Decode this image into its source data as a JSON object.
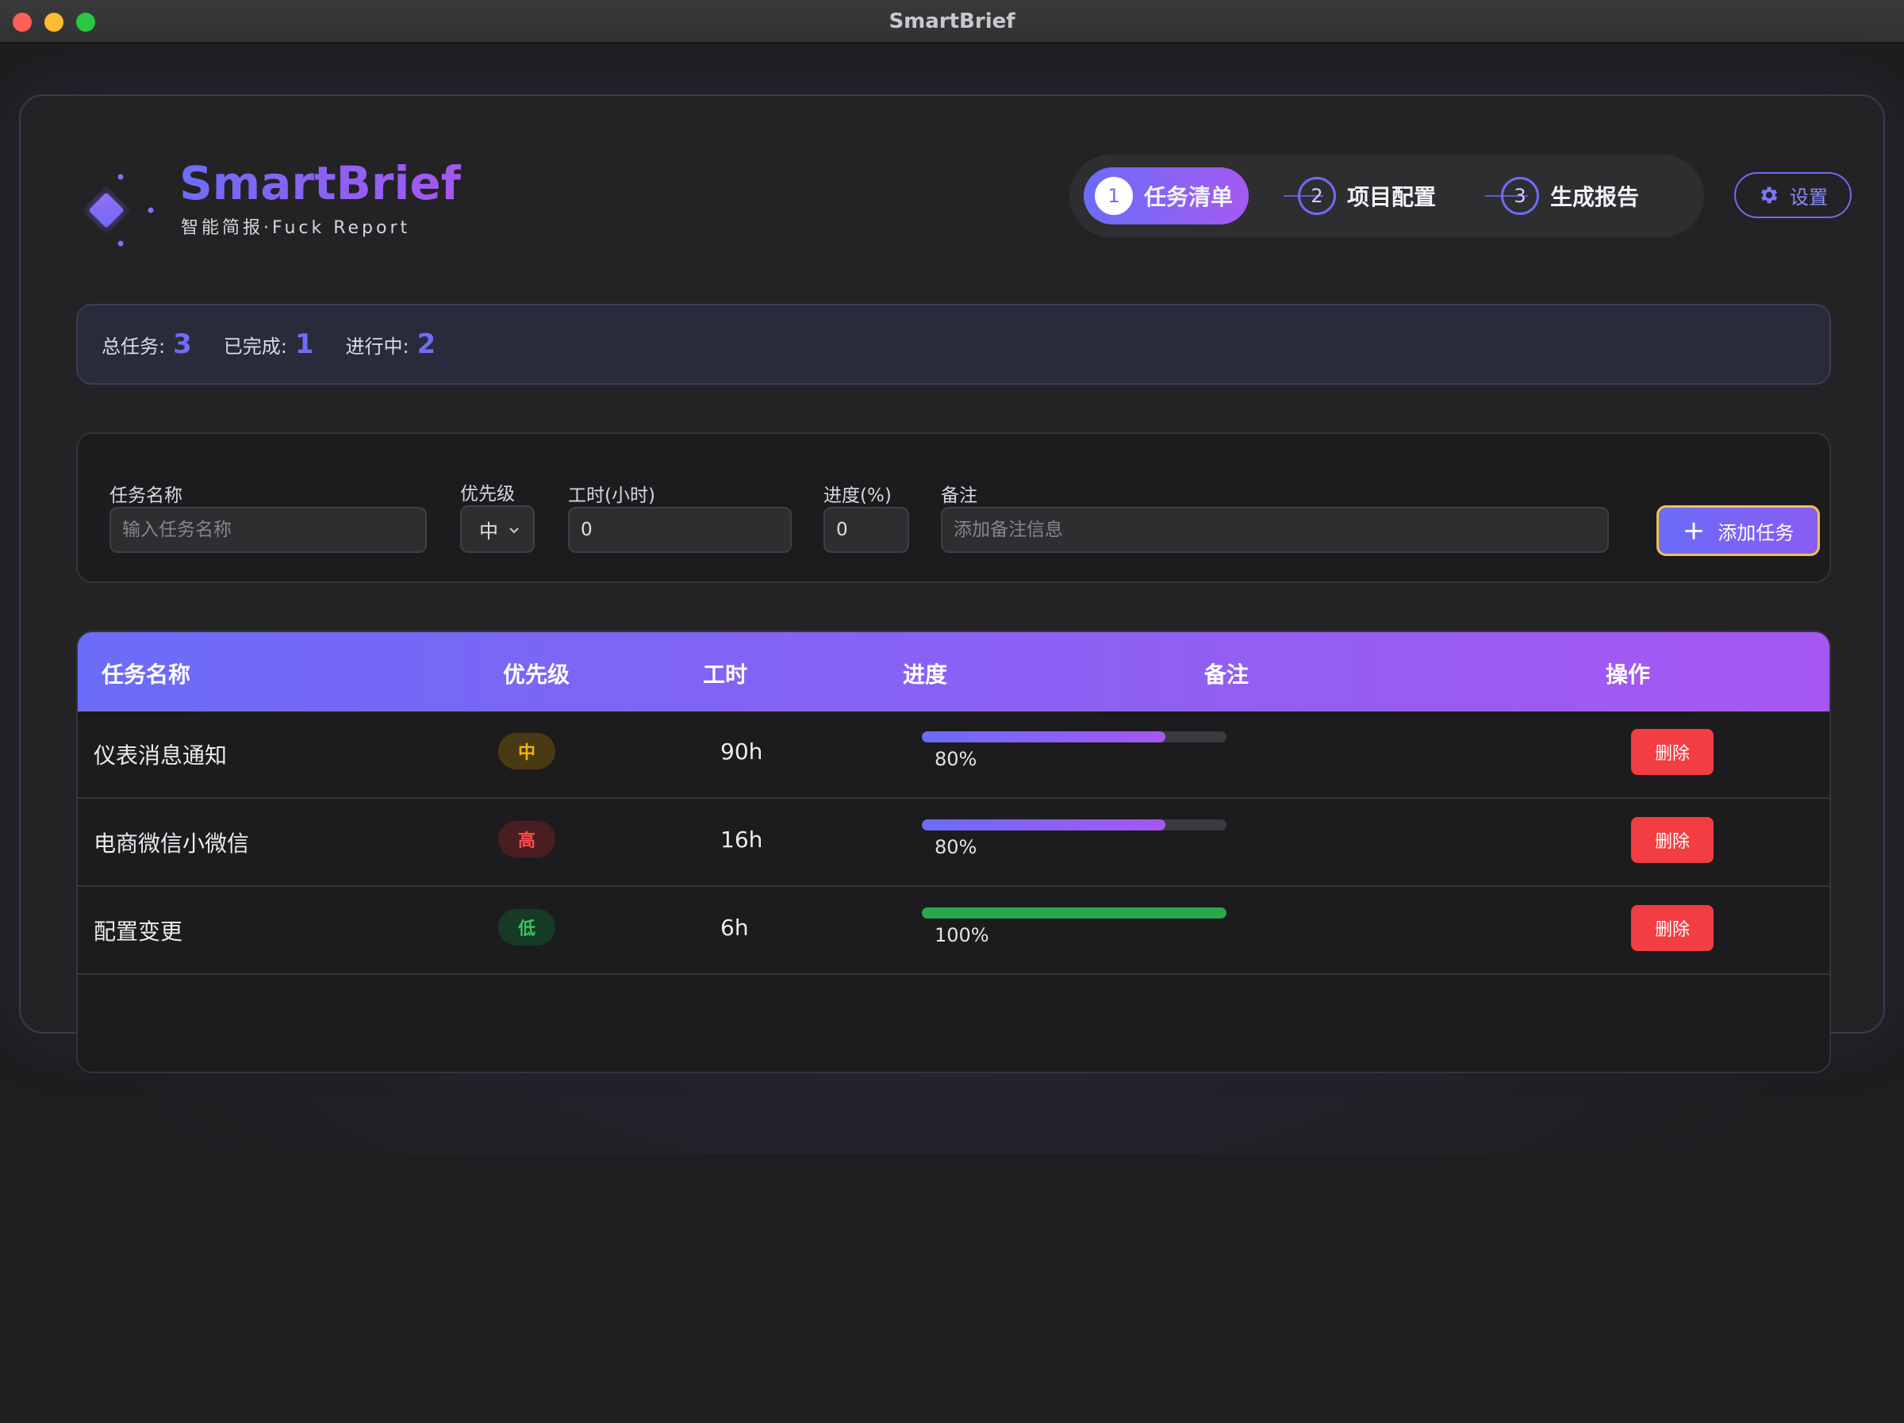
{
  "window": {
    "title": "SmartBrief"
  },
  "brand": {
    "name": "SmartBrief",
    "subtitle": "智能简报·Fuck Report"
  },
  "steps": [
    {
      "num": "1",
      "label": "任务清单",
      "active": true
    },
    {
      "num": "2",
      "label": "项目配置",
      "active": false
    },
    {
      "num": "3",
      "label": "生成报告",
      "active": false
    }
  ],
  "settings": {
    "label": "设置",
    "icon": "gear-icon"
  },
  "stats": {
    "total_label": "总任务:",
    "total_value": "3",
    "done_label": "已完成:",
    "done_value": "1",
    "progress_label": "进行中:",
    "progress_value": "2"
  },
  "form": {
    "name_label": "任务名称",
    "name_placeholder": "输入任务名称",
    "priority_label": "优先级",
    "priority_value": "中",
    "hours_label": "工时(小时)",
    "hours_value": "0",
    "progress_label": "进度(%)",
    "progress_value": "0",
    "note_label": "备注",
    "note_placeholder": "添加备注信息",
    "add_label": "添加任务"
  },
  "table": {
    "headers": [
      "任务名称",
      "优先级",
      "工时",
      "进度",
      "备注",
      "操作"
    ],
    "rows": [
      {
        "name": "仪表消息通知",
        "priority": "中",
        "priority_level": "medium",
        "hours": "90h",
        "progress": 80,
        "progress_label": "80%",
        "note": "",
        "action": "删除"
      },
      {
        "name": "电商微信小微信",
        "priority": "高",
        "priority_level": "high",
        "hours": "16h",
        "progress": 80,
        "progress_label": "80%",
        "note": "",
        "action": "删除"
      },
      {
        "name": "配置变更",
        "priority": "低",
        "priority_level": "low",
        "hours": "6h",
        "progress": 100,
        "progress_label": "100%",
        "note": "",
        "action": "删除"
      }
    ]
  },
  "colors": {
    "accent": "#6b6cf7",
    "accent_end": "#a657f1",
    "danger": "#f23d42",
    "complete": "#2aa84a",
    "priority_medium_bg": "#4a3a14",
    "priority_medium_fg": "#f4b400",
    "priority_high_bg": "#4a1e20",
    "priority_high_fg": "#ff4d4f",
    "priority_low_bg": "#173a24",
    "priority_low_fg": "#3cc168"
  }
}
